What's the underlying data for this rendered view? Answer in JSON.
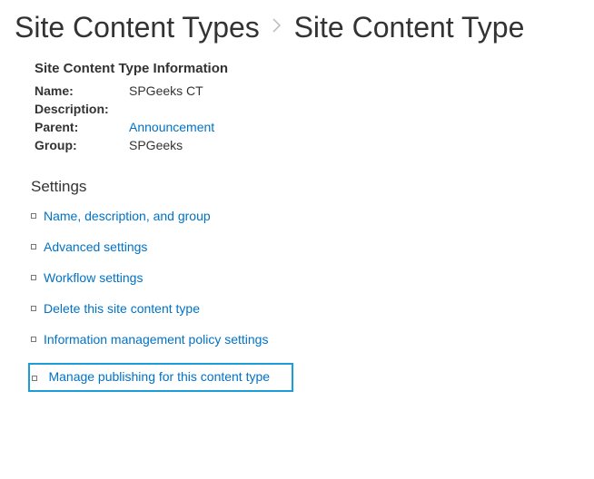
{
  "breadcrumb": {
    "parent": "Site Content Types",
    "current": "Site Content Type"
  },
  "info": {
    "heading": "Site Content Type Information",
    "name_label": "Name:",
    "name_value": "SPGeeks CT",
    "description_label": "Description:",
    "description_value": "",
    "parent_label": "Parent:",
    "parent_value": "Announcement",
    "group_label": "Group:",
    "group_value": "SPGeeks"
  },
  "settings": {
    "heading": "Settings",
    "items": [
      "Name, description, and group",
      "Advanced settings",
      "Workflow settings",
      "Delete this site content type",
      "Information management policy settings",
      "Manage publishing for this content type"
    ]
  }
}
